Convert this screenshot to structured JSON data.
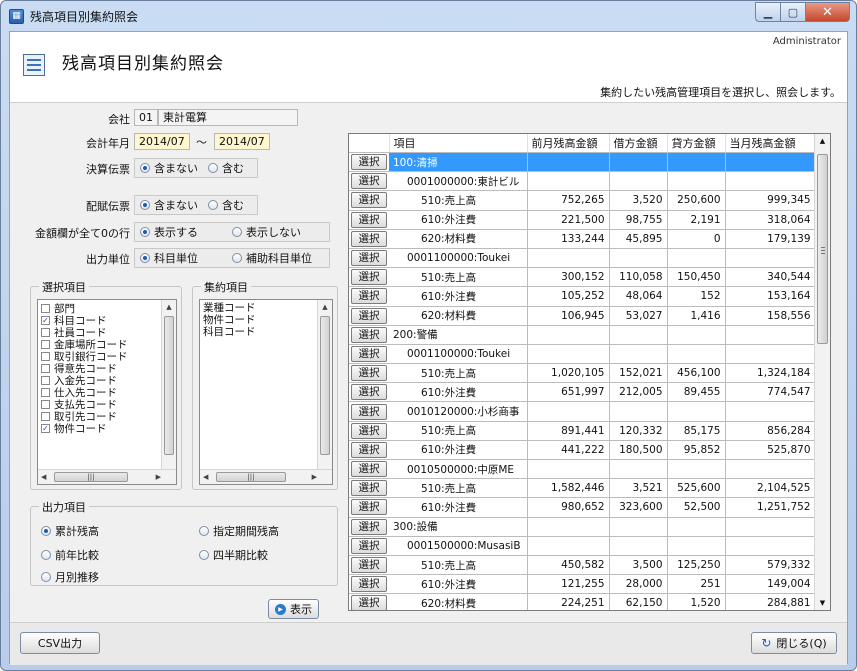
{
  "window": {
    "title": "残高項目別集約照会",
    "min": "▁",
    "max": "▢",
    "close": "✕"
  },
  "header": {
    "title": "残高項目別集約照会",
    "user": "Administrator",
    "description": "集約したい残高管理項目を選択し、照会します。"
  },
  "form": {
    "company_label": "会社",
    "company_code": "01",
    "company_name": "東計電算",
    "period_label": "会計年月",
    "period_from": "2014/07",
    "tilde": "〜",
    "period_to": "2014/07",
    "settlement_label": "決算伝票",
    "settlement_options": [
      "含まない",
      "含む"
    ],
    "settlement_selected": 0,
    "transfer_label": "配賦伝票",
    "transfer_options": [
      "含まない",
      "含む"
    ],
    "transfer_selected": 0,
    "zero_label": "金額欄が全て0の行",
    "zero_options": [
      "表示する",
      "表示しない"
    ],
    "zero_selected": 0,
    "unit_label": "出力単位",
    "unit_options": [
      "科目単位",
      "補助科目単位"
    ],
    "unit_selected": 0
  },
  "selection": {
    "title": "選択項目",
    "items": [
      {
        "label": "部門",
        "checked": false
      },
      {
        "label": "科目コード",
        "checked": true
      },
      {
        "label": "社員コード",
        "checked": false
      },
      {
        "label": "金庫場所コード",
        "checked": false
      },
      {
        "label": "取引銀行コード",
        "checked": false
      },
      {
        "label": "得意先コード",
        "checked": false
      },
      {
        "label": "入金先コード",
        "checked": false
      },
      {
        "label": "仕入先コード",
        "checked": false
      },
      {
        "label": "支払先コード",
        "checked": false
      },
      {
        "label": "取引先コード",
        "checked": false
      },
      {
        "label": "物件コード",
        "checked": true
      }
    ]
  },
  "aggregate": {
    "title": "集約項目",
    "items": [
      "業種コード",
      "物件コード",
      "科目コード"
    ]
  },
  "output": {
    "title": "出力項目",
    "options": [
      "累計残高",
      "指定期間残高",
      "前年比較",
      "四半期比較",
      "月別推移"
    ],
    "selected": 0
  },
  "show_button": "表示",
  "grid": {
    "select_label": "選択",
    "columns": [
      "項目",
      "前月残高金額",
      "借方金額",
      "貸方金額",
      "当月残高金額"
    ],
    "rows": [
      {
        "level": 0,
        "item": "100:清掃",
        "prev": "",
        "debit": "",
        "credit": "",
        "curr": "",
        "highlight": true
      },
      {
        "level": 1,
        "item": "0001000000:東計ビル",
        "prev": "",
        "debit": "",
        "credit": "",
        "curr": ""
      },
      {
        "level": 2,
        "item": "510:売上高",
        "prev": "752,265",
        "debit": "3,520",
        "credit": "250,600",
        "curr": "999,345"
      },
      {
        "level": 2,
        "item": "610:外注費",
        "prev": "221,500",
        "debit": "98,755",
        "credit": "2,191",
        "curr": "318,064"
      },
      {
        "level": 2,
        "item": "620:材料費",
        "prev": "133,244",
        "debit": "45,895",
        "credit": "0",
        "curr": "179,139"
      },
      {
        "level": 1,
        "item": "0001100000:Toukei",
        "prev": "",
        "debit": "",
        "credit": "",
        "curr": ""
      },
      {
        "level": 2,
        "item": "510:売上高",
        "prev": "300,152",
        "debit": "110,058",
        "credit": "150,450",
        "curr": "340,544"
      },
      {
        "level": 2,
        "item": "610:外注費",
        "prev": "105,252",
        "debit": "48,064",
        "credit": "152",
        "curr": "153,164"
      },
      {
        "level": 2,
        "item": "620:材料費",
        "prev": "106,945",
        "debit": "53,027",
        "credit": "1,416",
        "curr": "158,556"
      },
      {
        "level": 0,
        "item": "200:警備",
        "prev": "",
        "debit": "",
        "credit": "",
        "curr": ""
      },
      {
        "level": 1,
        "item": "0001100000:Toukei",
        "prev": "",
        "debit": "",
        "credit": "",
        "curr": ""
      },
      {
        "level": 2,
        "item": "510:売上高",
        "prev": "1,020,105",
        "debit": "152,021",
        "credit": "456,100",
        "curr": "1,324,184"
      },
      {
        "level": 2,
        "item": "610:外注費",
        "prev": "651,997",
        "debit": "212,005",
        "credit": "89,455",
        "curr": "774,547"
      },
      {
        "level": 1,
        "item": "0010120000:小杉商事",
        "prev": "",
        "debit": "",
        "credit": "",
        "curr": ""
      },
      {
        "level": 2,
        "item": "510:売上高",
        "prev": "891,441",
        "debit": "120,332",
        "credit": "85,175",
        "curr": "856,284"
      },
      {
        "level": 2,
        "item": "610:外注費",
        "prev": "441,222",
        "debit": "180,500",
        "credit": "95,852",
        "curr": "525,870"
      },
      {
        "level": 1,
        "item": "0010500000:中原ME",
        "prev": "",
        "debit": "",
        "credit": "",
        "curr": ""
      },
      {
        "level": 2,
        "item": "510:売上高",
        "prev": "1,582,446",
        "debit": "3,521",
        "credit": "525,600",
        "curr": "2,104,525"
      },
      {
        "level": 2,
        "item": "610:外注費",
        "prev": "980,652",
        "debit": "323,600",
        "credit": "52,500",
        "curr": "1,251,752"
      },
      {
        "level": 0,
        "item": "300:設備",
        "prev": "",
        "debit": "",
        "credit": "",
        "curr": ""
      },
      {
        "level": 1,
        "item": "0001500000:MusasiB",
        "prev": "",
        "debit": "",
        "credit": "",
        "curr": ""
      },
      {
        "level": 2,
        "item": "510:売上高",
        "prev": "450,582",
        "debit": "3,500",
        "credit": "125,250",
        "curr": "579,332"
      },
      {
        "level": 2,
        "item": "610:外注費",
        "prev": "121,255",
        "debit": "28,000",
        "credit": "251",
        "curr": "149,004"
      },
      {
        "level": 2,
        "item": "620:材料費",
        "prev": "224,251",
        "debit": "62,150",
        "credit": "1,520",
        "curr": "284,881"
      }
    ]
  },
  "footer": {
    "csv_button": "CSV出力",
    "close_button": "閉じる(Q)"
  },
  "colors": {
    "highlight": "#3399ff",
    "input_yellow": "#fff6cf"
  }
}
